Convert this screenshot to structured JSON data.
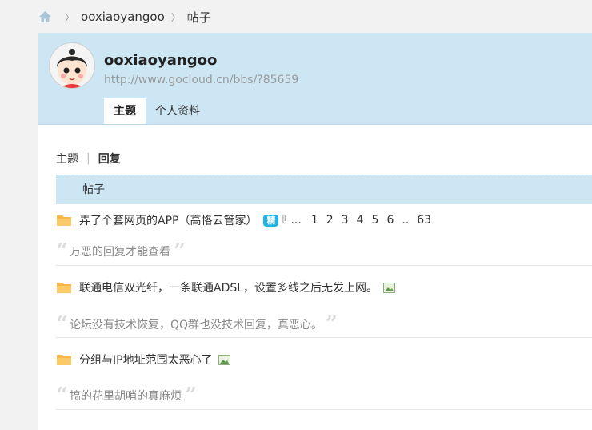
{
  "breadcrumb": {
    "user": "ooxiaoyangoo",
    "page": "帖子"
  },
  "profile": {
    "username": "ooxiaoyangoo",
    "url": "http://www.gocloud.cn/bbs/?85659",
    "tabs": [
      "主题",
      "个人资料"
    ]
  },
  "subtabs": {
    "topics": "主题",
    "separator": "|",
    "replies": "回复"
  },
  "table": {
    "header": "帖子"
  },
  "threads": [
    {
      "title": "弄了个套网页的APP（高恪云管家）",
      "badge": "精",
      "ellipsis": "...",
      "pages": [
        "1",
        "2",
        "3",
        "4",
        "5",
        "6",
        "..",
        "63"
      ],
      "quote": "万恶的回复才能查看"
    },
    {
      "title": "联通电信双光纤，一条联通ADSL，设置多线之后无发上网。",
      "quote": "论坛没有技术恢复，QQ群也没技术回复，真恶心。"
    },
    {
      "title": "分组与IP地址范围太恶心了",
      "quote": "搞的花里胡哨的真麻烦"
    }
  ],
  "colors": {
    "header_bg": "#cde6f4",
    "badge": "#1eb4e5",
    "folder": "#f8b84a"
  }
}
